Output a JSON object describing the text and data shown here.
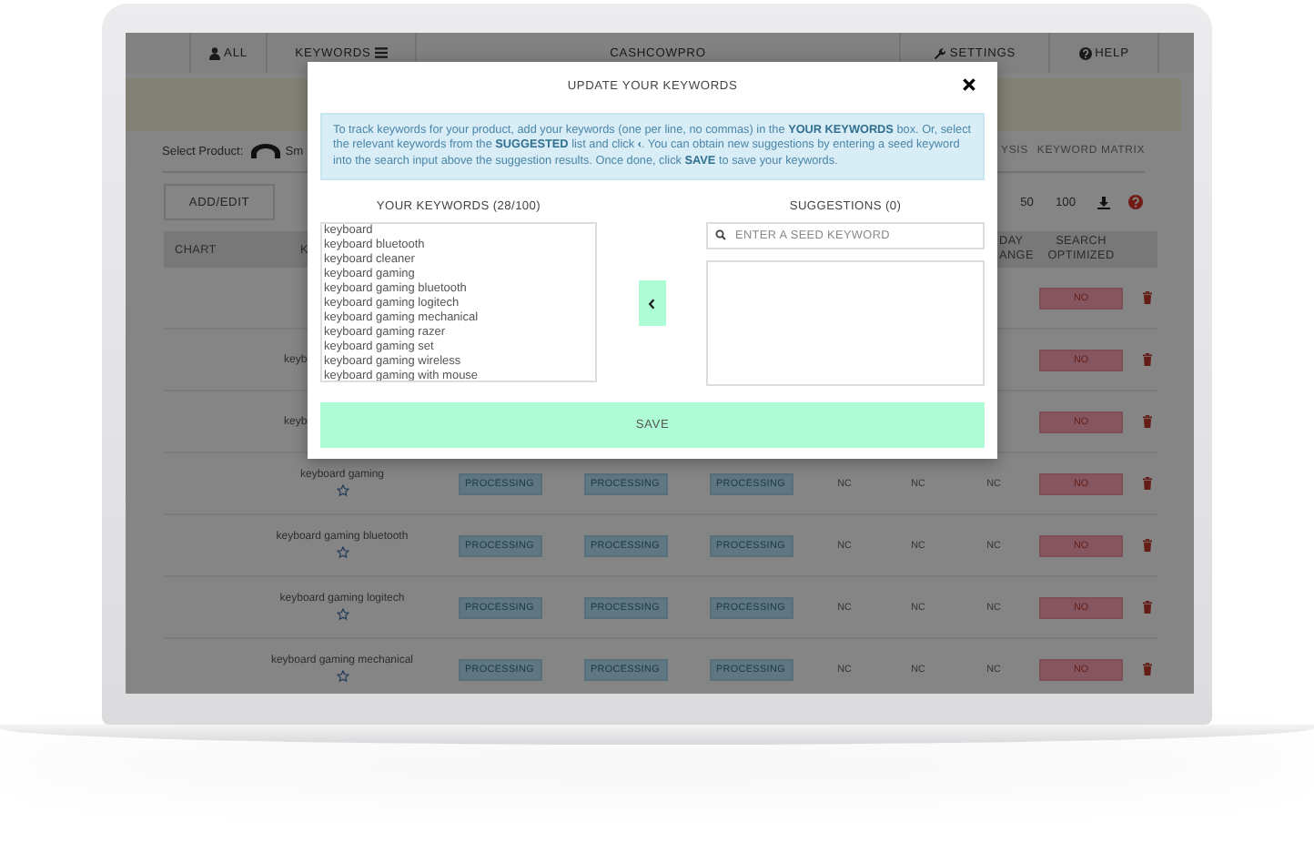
{
  "nav": {
    "items": [
      {
        "kind": "user",
        "label": "ALL"
      },
      {
        "kind": "menu",
        "label": "KEYWORDS"
      },
      {
        "kind": "brand",
        "label": "CASHCOWPRO"
      },
      {
        "kind": "wrench",
        "label": "SETTINGS"
      },
      {
        "kind": "help",
        "label": "HELP"
      }
    ]
  },
  "product_bar": {
    "label": "Select Product:",
    "product": "Sm",
    "tabs": [
      {
        "label": "YSIS",
        "selected": false
      },
      {
        "label": "KEYWORD MATRIX",
        "selected": false
      }
    ]
  },
  "toolbar": {
    "button": "ADD/EDIT",
    "page_sizes": [
      "50",
      "100"
    ]
  },
  "table": {
    "columns": [
      "CHART",
      "K",
      "DAY ANGE",
      "SEARCH OPTIMIZED"
    ],
    "rows": [
      {
        "kind": "covered",
        "optimized": "NO"
      },
      {
        "kind": "covered",
        "keyword": "keyb",
        "optimized": "NO"
      },
      {
        "kind": "covered",
        "keyword": "keyb",
        "optimized": "NO"
      },
      {
        "kind": "full",
        "keyword": "keyboard gaming",
        "starred": false,
        "ranks": [
          "PROCESSING",
          "PROCESSING",
          "PROCESSING"
        ],
        "changes": [
          "NC",
          "NC",
          "NC"
        ],
        "optimized": "NO"
      },
      {
        "kind": "full",
        "keyword": "keyboard gaming bluetooth",
        "starred": false,
        "ranks": [
          "PROCESSING",
          "PROCESSING",
          "PROCESSING"
        ],
        "changes": [
          "NC",
          "NC",
          "NC"
        ],
        "optimized": "NO"
      },
      {
        "kind": "full",
        "keyword": "keyboard gaming logitech",
        "starred": false,
        "ranks": [
          "PROCESSING",
          "PROCESSING",
          "PROCESSING"
        ],
        "changes": [
          "NC",
          "NC",
          "NC"
        ],
        "optimized": "NO"
      },
      {
        "kind": "full",
        "keyword": "keyboard gaming mechanical",
        "starred": false,
        "ranks": [
          "PROCESSING",
          "PROCESSING",
          "PROCESSING"
        ],
        "changes": [
          "NC",
          "NC",
          "NC"
        ],
        "optimized": "NO"
      }
    ]
  },
  "modal": {
    "title": "UPDATE YOUR KEYWORDS",
    "info": "To track keywords for your product, add your keywords (one per line, no commas) in the **YOUR KEYWORDS** box. Or, select the relevant keywords from the **SUGGESTED** list and click **‹**. You can obtain new suggestions by entering a seed keyword into the search input above the suggestion results. Once done, click **SAVE** to save your keywords.",
    "keywords_label": "YOUR KEYWORDS (28/100)",
    "keywords": [
      "keyboard",
      "keyboard bluetooth",
      "keyboard cleaner",
      "keyboard gaming",
      "keyboard gaming bluetooth",
      "keyboard gaming logitech",
      "keyboard gaming mechanical",
      "keyboard gaming razer",
      "keyboard gaming set",
      "keyboard gaming wireless",
      "keyboard gaming with mouse"
    ],
    "suggestions_label": "SUGGESTIONS (0)",
    "search": {
      "placeholder": "ENTER A SEED KEYWORD"
    },
    "save": "SAVE"
  }
}
